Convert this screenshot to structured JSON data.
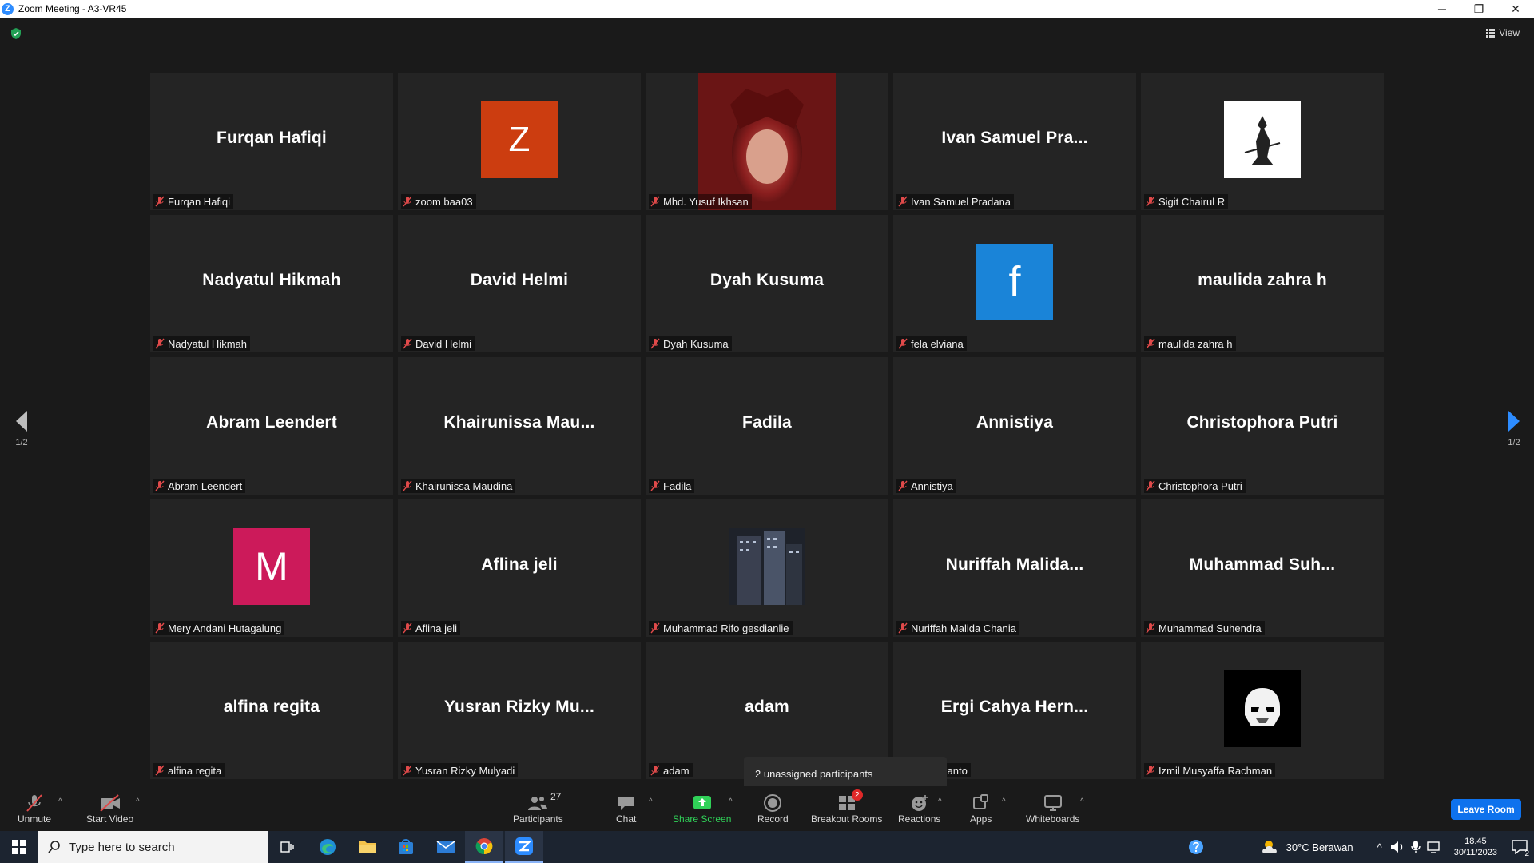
{
  "window": {
    "title": "Zoom Meeting - A3-VR45",
    "logo_letter": "Z",
    "minimize": "─",
    "maximize": "❐",
    "close": "✕"
  },
  "view_button": {
    "label": "View"
  },
  "pager": {
    "left": "1/2",
    "right": "1/2"
  },
  "participants": [
    {
      "big": "Furqan Hafiqi",
      "label": "Furqan Hafiqi"
    },
    {
      "avatar": "Z",
      "label": "zoom baa03"
    },
    {
      "avatar_photo": "photo",
      "label": "Mhd. Yusuf Ikhsan"
    },
    {
      "big": "Ivan Samuel Pra...",
      "label": "Ivan Samuel Pradana"
    },
    {
      "avatar_photo": "photo",
      "label": "Sigit Chairul R"
    },
    {
      "big": "Nadyatul Hikmah",
      "label": "Nadyatul Hikmah"
    },
    {
      "big": "David Helmi",
      "label": "David Helmi"
    },
    {
      "big": "Dyah Kusuma",
      "label": "Dyah Kusuma"
    },
    {
      "avatar": "f",
      "label": "fela elviana"
    },
    {
      "big": "maulida zahra h",
      "label": "maulida zahra h"
    },
    {
      "big": "Abram Leendert",
      "label": "Abram Leendert"
    },
    {
      "big": "Khairunissa  Mau...",
      "label": "Khairunissa Maudina"
    },
    {
      "big": "Fadila",
      "label": "Fadila"
    },
    {
      "big": "Annistiya",
      "label": "Annistiya"
    },
    {
      "big": "Christophora Putri",
      "label": "Christophora Putri"
    },
    {
      "avatar": "M",
      "label": "Mery Andani Hutagalung"
    },
    {
      "big": "Aflina jeli",
      "label": "Aflina jeli"
    },
    {
      "avatar_photo": "photo",
      "label": "Muhammad Rifo gesdianlie"
    },
    {
      "big": "Nuriffah  Malida...",
      "label": "Nuriffah Malida Chania"
    },
    {
      "big": "Muhammad  Suh...",
      "label": "Muhammad Suhendra"
    },
    {
      "big": "alfina regita",
      "label": "alfina regita"
    },
    {
      "big": "Yusran Rizky Mu...",
      "label": "Yusran Rizky Mulyadi"
    },
    {
      "big": "adam",
      "label": "adam"
    },
    {
      "big": "Ergi Cahya Hern...",
      "label": "ya Hernanto"
    },
    {
      "avatar_photo": "photo",
      "label": "Izmil Musyaffa Rachman"
    }
  ],
  "tooltip": "2 unassigned participants",
  "toolbar": {
    "unmute": "Unmute",
    "start_video": "Start Video",
    "participants": "Participants",
    "participants_count": "27",
    "chat": "Chat",
    "share_screen": "Share Screen",
    "record": "Record",
    "breakout_rooms": "Breakout Rooms",
    "breakout_badge": "2",
    "reactions": "Reactions",
    "apps": "Apps",
    "whiteboards": "Whiteboards",
    "leave": "Leave Room"
  },
  "taskbar": {
    "search_placeholder": "Type here to search",
    "weather": "30°C  Berawan",
    "time": "18.45",
    "date": "30/11/2023",
    "notifications": "2"
  },
  "colors": {
    "accent": "#0e72ed",
    "share": "#30d158",
    "badge": "#e02828",
    "mic_muted": "#e04a4a"
  }
}
